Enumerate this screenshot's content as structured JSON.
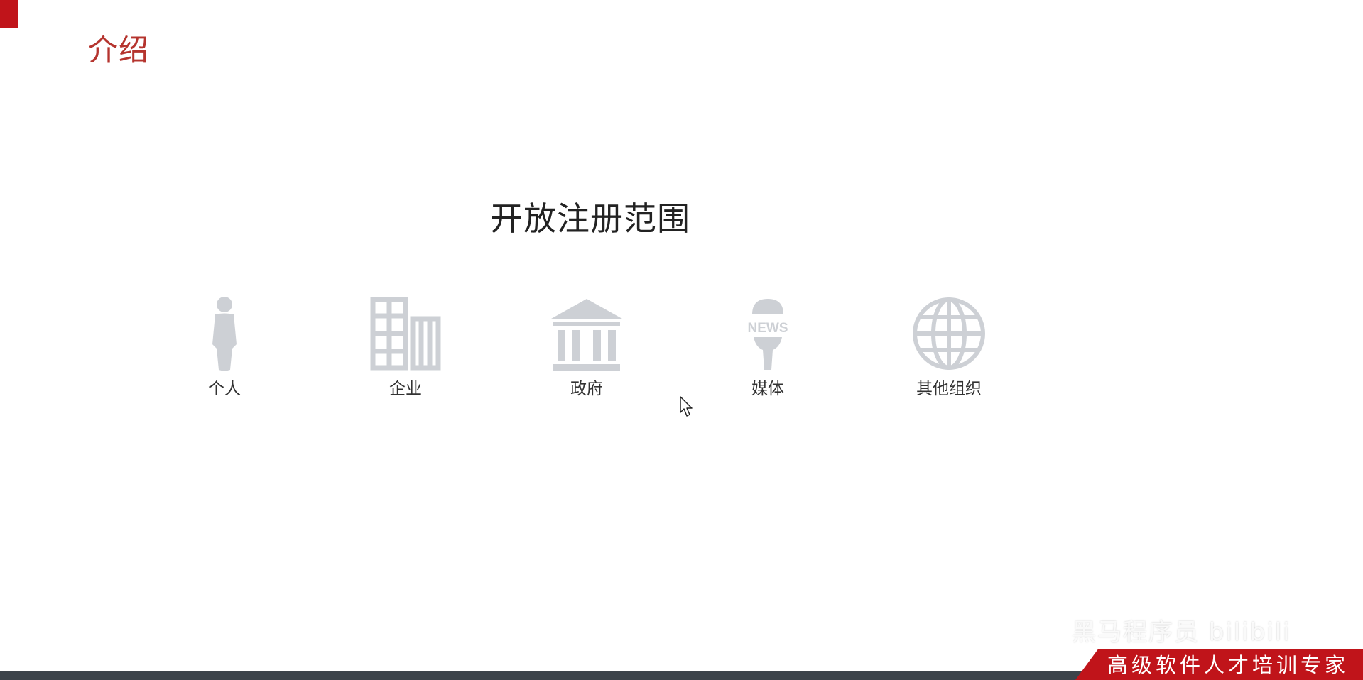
{
  "slide": {
    "title": "介绍",
    "heading": "开放注册范围"
  },
  "scope_items": [
    {
      "label": "个人",
      "icon": "person-icon"
    },
    {
      "label": "企业",
      "icon": "office-building-icon"
    },
    {
      "label": "政府",
      "icon": "government-building-icon"
    },
    {
      "label": "媒体",
      "icon": "news-microphone-icon",
      "icon_text": "NEWS"
    },
    {
      "label": "其他组织",
      "icon": "globe-icon"
    }
  ],
  "footer": {
    "slogan": "高级软件人才培训专家",
    "watermark": "黑马程序员 bilibili"
  },
  "colors": {
    "accent": "#c0141a",
    "title": "#b5342e",
    "icon": "#cdd0d5",
    "bottom_bar": "#3c434a"
  }
}
